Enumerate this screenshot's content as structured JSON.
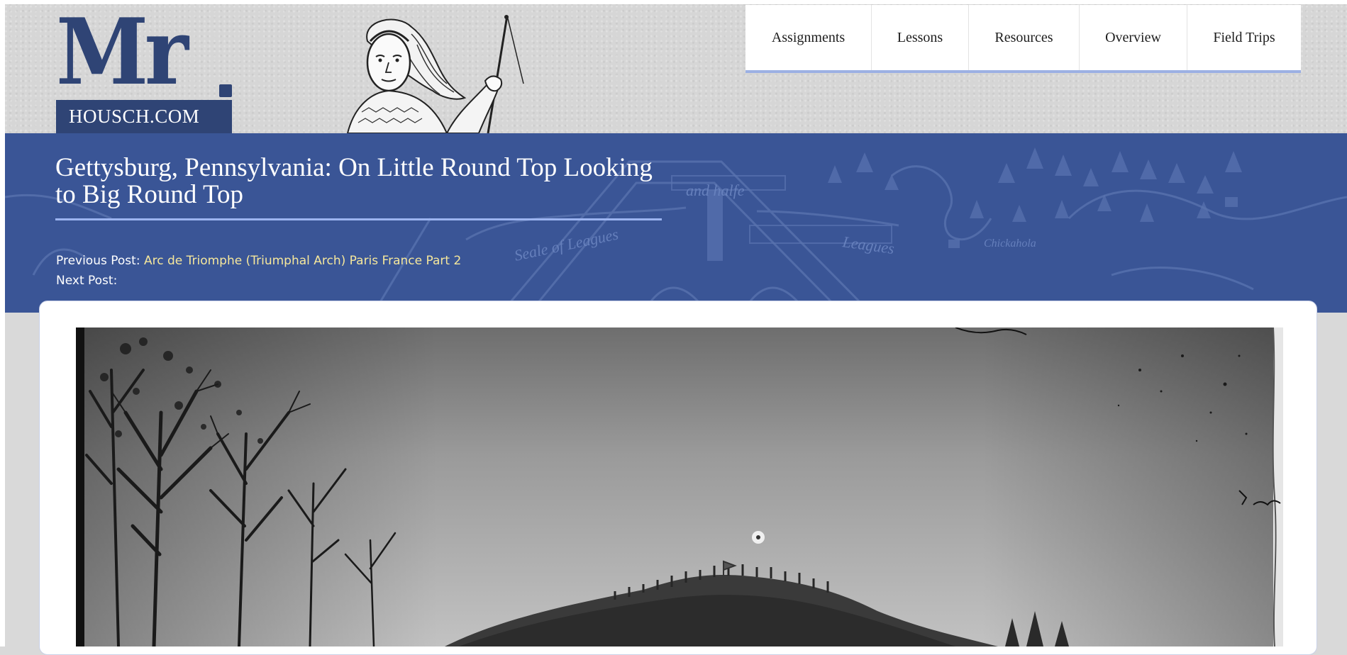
{
  "logo": {
    "big_text": "Mr",
    "domain": "HOUSCH.COM"
  },
  "nav": {
    "items": [
      {
        "label": "Assignments"
      },
      {
        "label": "Lessons"
      },
      {
        "label": "Resources"
      },
      {
        "label": "Overview"
      },
      {
        "label": "Field Trips"
      }
    ]
  },
  "post": {
    "title": "Gettysburg, Pennsylvania: On Little Round Top Looking to Big Round Top",
    "previous_label": "Previous Post:",
    "previous_link": "Arc de Triomphe (Triumphal Arch) Paris France Part 2",
    "next_label": "Next Post:"
  },
  "banner_map": {
    "labels": [
      "and halfe",
      "Seale of Leagues",
      "Leagues",
      "Chickahola"
    ]
  },
  "colors": {
    "brand_navy": "#2f4475",
    "banner_blue": "#3a5596",
    "accent_light_blue": "#9cb4f0",
    "link_yellow": "#f5e79c"
  }
}
